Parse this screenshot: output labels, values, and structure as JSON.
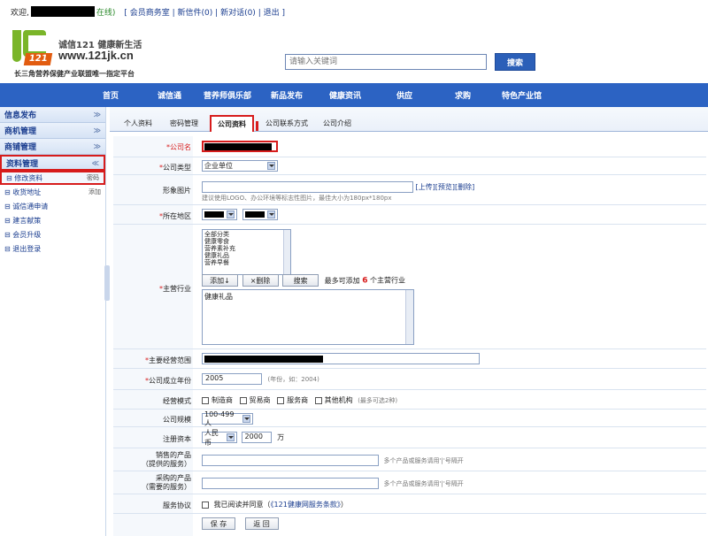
{
  "topbar": {
    "welcome": "欢迎,",
    "online": "在线)",
    "links": [
      "[ 会员商务室",
      "| 新信件(0)",
      "| 新对话(0)",
      "| 退出 ]"
    ]
  },
  "logo": {
    "brand_cn": "诚信121 健康新生活",
    "url": "www.121jk.cn",
    "tagline": "长三角营养保健产业联盟唯一指定平台",
    "mark_num": "121"
  },
  "search": {
    "placeholder": "请输入关键词",
    "button": "搜索"
  },
  "nav": [
    "首页",
    "诚信通",
    "营养师俱乐部",
    "新品发布",
    "健康资讯",
    "供应",
    "求购",
    "特色产业馆"
  ],
  "sidebar": {
    "sections": [
      {
        "label": "信息发布",
        "chev": "≫"
      },
      {
        "label": "商机管理",
        "chev": "≫"
      },
      {
        "label": "商铺管理",
        "chev": "≫"
      },
      {
        "label": "资料管理",
        "chev": "≪"
      }
    ],
    "items": [
      {
        "label": "修改资料",
        "tag": "密码"
      },
      {
        "label": "收货地址",
        "tag": "添加"
      },
      {
        "label": "诚信通申请",
        "tag": ""
      },
      {
        "label": "建言献策",
        "tag": ""
      },
      {
        "label": "会员升级",
        "tag": ""
      },
      {
        "label": "退出登录",
        "tag": ""
      }
    ]
  },
  "tabs": [
    "个人资料",
    "密码管理",
    "公司资料",
    "公司联系方式",
    "公司介绍"
  ],
  "form": {
    "company_name_label": "*公司名",
    "company_type_label": "*公司类型",
    "company_type_value": "企业单位",
    "image_label": "形象图片",
    "image_links": [
      "[上传]",
      "[预览]",
      "[删除]"
    ],
    "image_hint": "建议使用LOGO、办公环境等标志性图片，最佳大小为180px*180px",
    "region_label": "*所在地区",
    "industry_label": "*主营行业",
    "industry_options": [
      "全部分类",
      "健康零食",
      "营养素补充",
      "健康礼品",
      "营养早餐"
    ],
    "industry_buttons": [
      "添加↓",
      "×删除",
      "搜索"
    ],
    "industry_limit_prefix": "最多可添加",
    "industry_limit_num": "6",
    "industry_limit_suffix": "个主营行业",
    "industry_selected": "健康礼品",
    "scope_label": "*主要经营范围",
    "founded_label": "*公司成立年份",
    "founded_value": "2005",
    "founded_hint": "(年份，如：2004)",
    "mode_label": "经营模式",
    "mode_options": [
      "制造商",
      "贸易商",
      "服务商",
      "其他机构"
    ],
    "mode_hint": "(最多可选2种)",
    "size_label": "公司规模",
    "size_value": "100-499人",
    "capital_label": "注册资本",
    "capital_currency": "人民币",
    "capital_value": "2000",
    "capital_unit": "万",
    "sell_label_1": "销售的产品",
    "sell_label_2": "（提供的服务）",
    "sell_hint": "多个产品或服务请用'|'号隔开",
    "buy_label_1": "采购的产品",
    "buy_label_2": "（需要的服务）",
    "buy_hint": "多个产品或服务请用'|'号隔开",
    "agreement_label": "服务协议",
    "agreement_text": "我已阅读并同意（",
    "agreement_link": "《121健康网服务条款》",
    "agreement_end": "）",
    "save_button": "保 存",
    "back_button": "返 回"
  }
}
